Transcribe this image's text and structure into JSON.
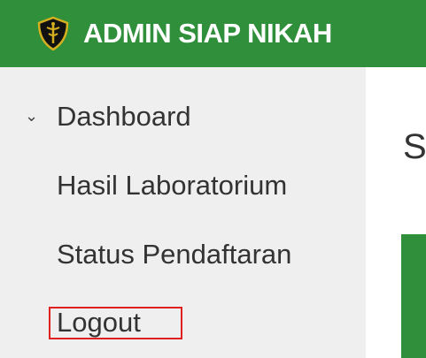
{
  "header": {
    "title": "ADMIN SIAP NIKAH",
    "logo_icon": "shield-caduceus-icon",
    "background_color": "#2f8f3a"
  },
  "sidebar": {
    "items": [
      {
        "label": "Dashboard",
        "expanded": true,
        "icon": "chevron-down-icon"
      },
      {
        "label": "Hasil Laboratorium"
      },
      {
        "label": "Status Pendaftaran"
      },
      {
        "label": "Logout",
        "highlighted": true
      }
    ],
    "background_color": "#efefef"
  },
  "main": {
    "heading_partial": "S",
    "card_color": "#2f8f3a"
  },
  "highlight_color": "#e0201e"
}
